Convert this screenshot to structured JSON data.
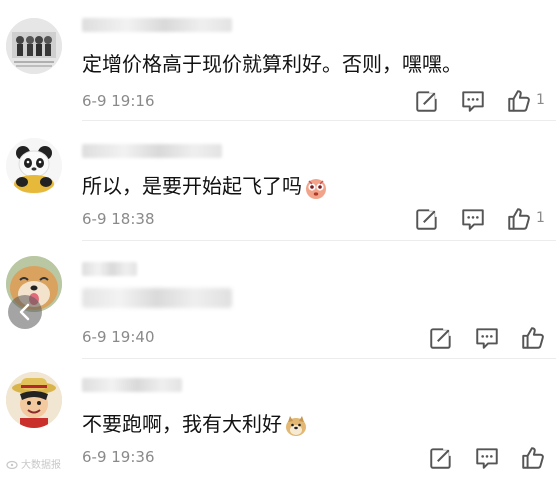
{
  "comments": [
    {
      "text": "定增价格高于现价就算利好。否则，嘿嘿。",
      "time": "6-9 19:16",
      "like_count": "1",
      "avatar_icon": "group-photo-avatar"
    },
    {
      "text": "所以，是要开始起飞了吗",
      "emoji_icon": "surprised-face-emoji",
      "time": "6-9 18:38",
      "like_count": "1",
      "avatar_icon": "panda-avatar"
    },
    {
      "text_partial": "...线...",
      "time": "6-9 19:40",
      "like_count": "",
      "avatar_icon": "shiba-dog-avatar"
    },
    {
      "text": "不要跑啊，我有大利好",
      "emoji_icon": "doge-emoji",
      "time": "6-9 19:36",
      "like_count": "",
      "avatar_icon": "luffy-avatar"
    }
  ],
  "actions": {
    "share_icon": "share-icon",
    "reply_icon": "comment-icon",
    "like_icon": "thumbs-up-icon"
  },
  "watermark": {
    "text": "大数据报"
  },
  "colors": {
    "text": "#111111",
    "meta": "#8a8a8a",
    "divider": "#ececec"
  }
}
